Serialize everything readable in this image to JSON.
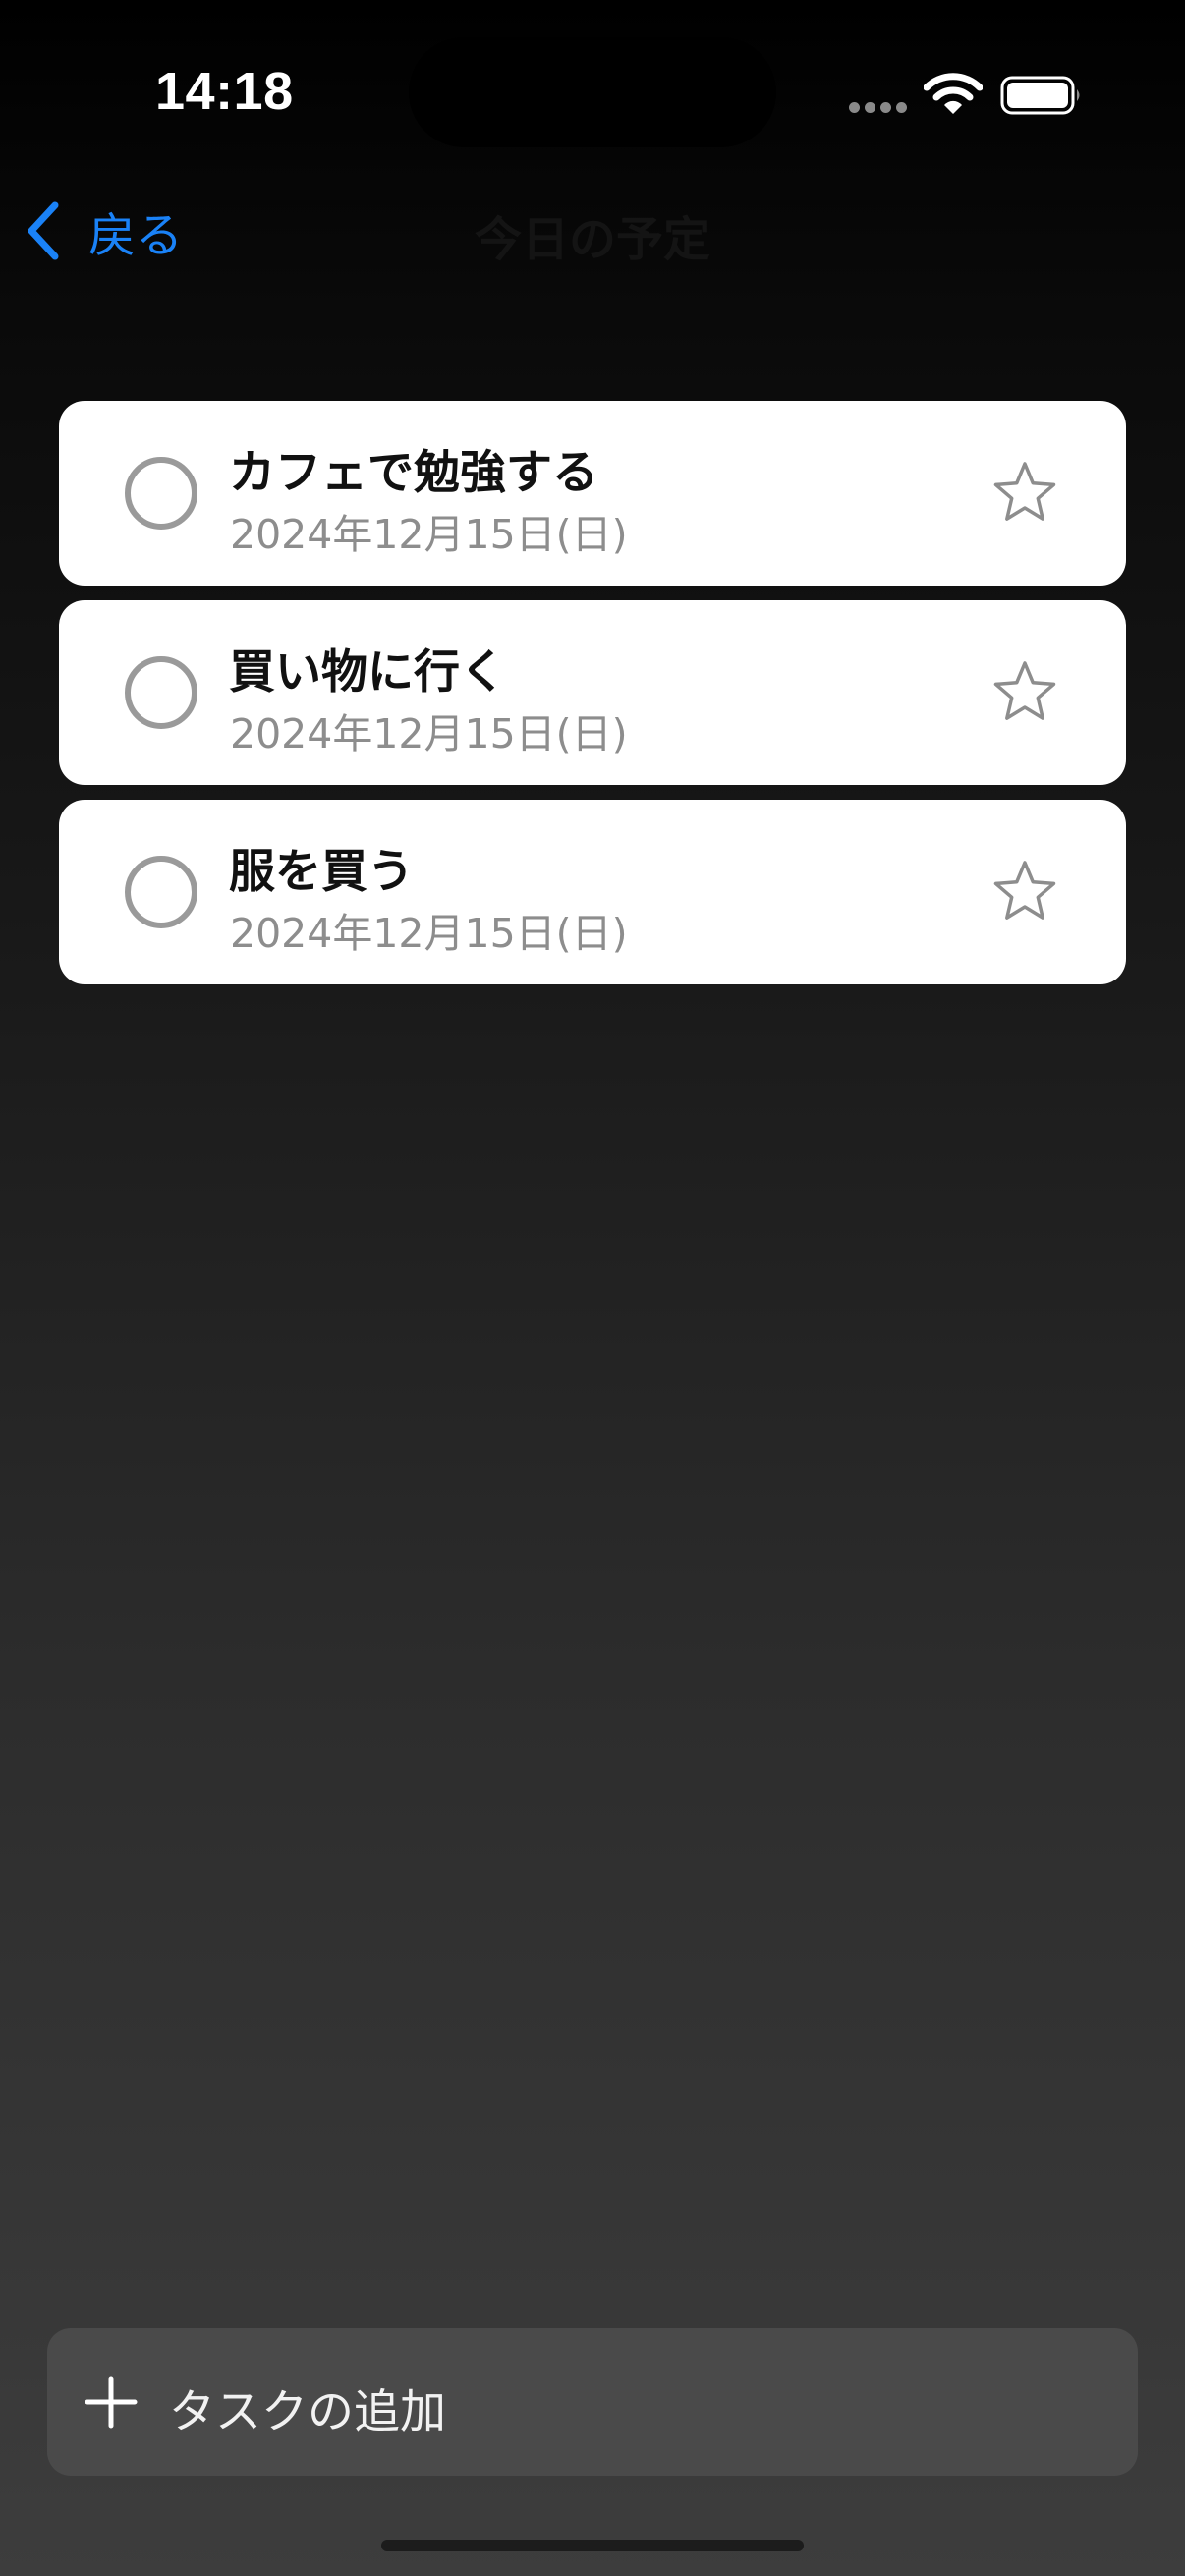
{
  "status_bar": {
    "time": "14:18",
    "signal_icon": "signal-dots-icon",
    "wifi_icon": "wifi-icon",
    "battery_icon": "battery-icon"
  },
  "nav": {
    "back_label": "戻る",
    "back_icon": "chevron-left-icon",
    "title": "今日の予定"
  },
  "tasks": [
    {
      "title": "カフェで勉強する",
      "date": "2024年12月15日(日)",
      "completed": false,
      "starred": false
    },
    {
      "title": "買い物に行く",
      "date": "2024年12月15日(日)",
      "completed": false,
      "starred": false
    },
    {
      "title": "服を買う",
      "date": "2024年12月15日(日)",
      "completed": false,
      "starred": false
    }
  ],
  "add_task": {
    "label": "タスクの追加",
    "icon": "plus-icon"
  },
  "colors": {
    "accent": "#1a82f7",
    "card_background": "#ffffff",
    "date_text": "#8d8d8d",
    "add_button_background": "#4a4a4a"
  }
}
